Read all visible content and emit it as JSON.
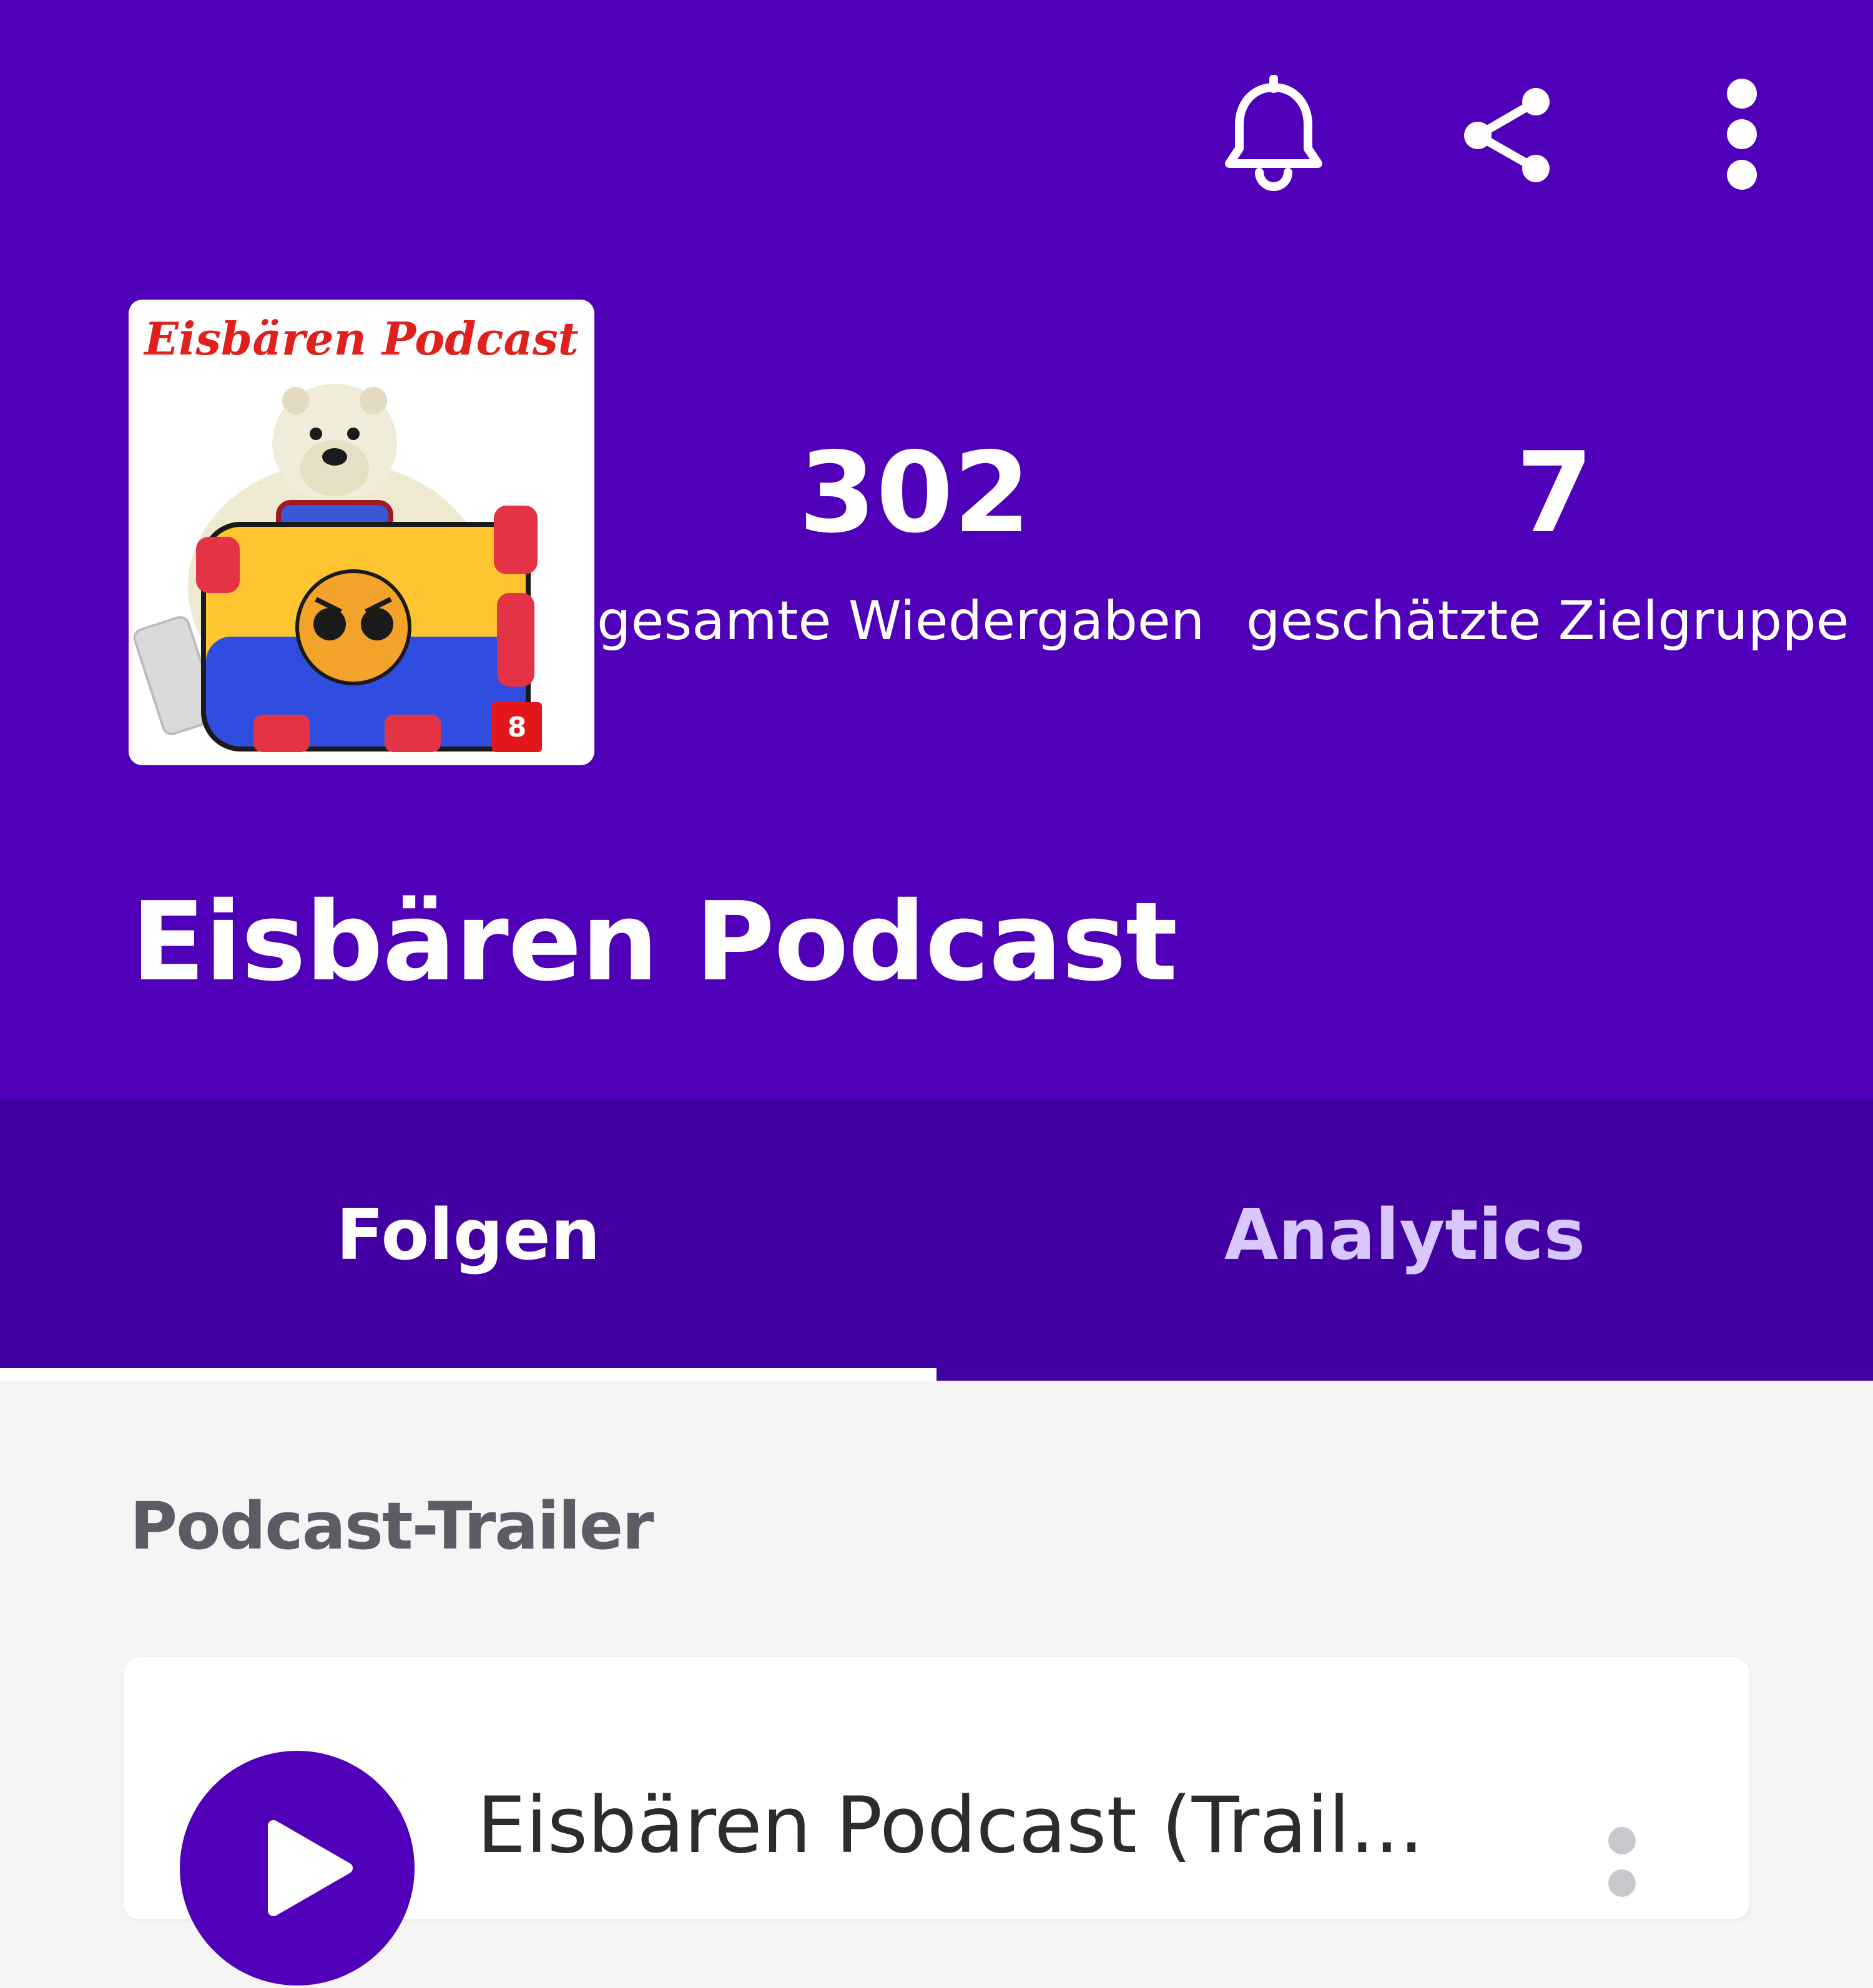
{
  "colors": {
    "header_bg": "#5000b9",
    "tabs_bg": "#4200a3",
    "active_tab_text": "#ffffff",
    "inactive_tab_text": "#d8c8ff",
    "page_bg": "#f5f5f5"
  },
  "toolbar": {
    "icons": [
      "bell-icon",
      "share-icon",
      "more-vert-icon"
    ]
  },
  "podcast": {
    "cover_title": "Eisbären Podcast",
    "cover_badge": "8",
    "title": "Eisbären Podcast"
  },
  "stats": {
    "plays_value": "302",
    "plays_label": "gesamte Wiedergaben",
    "audience_value": "7",
    "audience_label": "geschätzte Zielgruppe"
  },
  "tabs": [
    {
      "label": "Folgen",
      "active": true
    },
    {
      "label": "Analytics",
      "active": false
    }
  ],
  "trailer": {
    "section_label": "Podcast-Trailer",
    "episode_title": "Eisbären Podcast  (Trail..."
  }
}
